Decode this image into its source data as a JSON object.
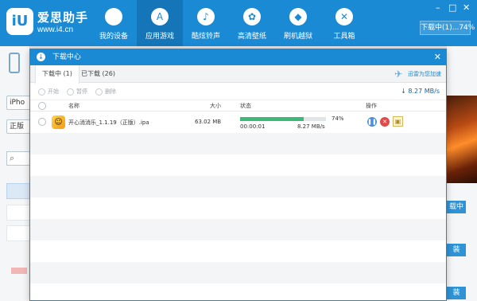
{
  "app": {
    "logo_text": "iU",
    "brand_name": "爱思助手",
    "brand_url": "www.i4.cn",
    "nav": [
      {
        "label": "我的设备",
        "icon": "apple-icon"
      },
      {
        "label": "应用游戏",
        "icon": "app-store-icon",
        "active": true
      },
      {
        "label": "酷炫铃声",
        "icon": "bell-icon"
      },
      {
        "label": "高清壁纸",
        "icon": "flower-icon"
      },
      {
        "label": "刷机越狱",
        "icon": "dropbox-icon"
      },
      {
        "label": "工具箱",
        "icon": "tools-icon"
      }
    ],
    "download_status_button": "下载中(1)...74%",
    "left_panel": {
      "device_label": "iPho",
      "edition_label": "正版",
      "search_icon": "search-icon"
    },
    "right_panel": {
      "button_1": "载中",
      "button_2": "装",
      "button_3": "装"
    }
  },
  "dialog": {
    "title": "下载中心",
    "tabs": [
      {
        "label": "下载中 (1)",
        "active": true
      },
      {
        "label": "已下载 (26)",
        "active": false
      }
    ],
    "promo_text": "迅雷为您加速",
    "toolbar": {
      "start": "开始",
      "pause": "暂停",
      "delete": "删除"
    },
    "speed": "8.27 MB/s",
    "columns": {
      "name": "名称",
      "size": "大小",
      "status": "状态",
      "action": "操作"
    },
    "rows": [
      {
        "name": "开心消消乐_1.1.19（正版）.ipa",
        "size": "63.02 MB",
        "progress": 74,
        "progress_label": "74%",
        "elapsed": "00:00:01",
        "speed": "8.27 MB/s",
        "actions": [
          "pause-icon",
          "cancel-icon",
          "folder-icon"
        ]
      }
    ],
    "colors": {
      "accent": "#1a8ad4",
      "progress": "#3cb878"
    }
  }
}
